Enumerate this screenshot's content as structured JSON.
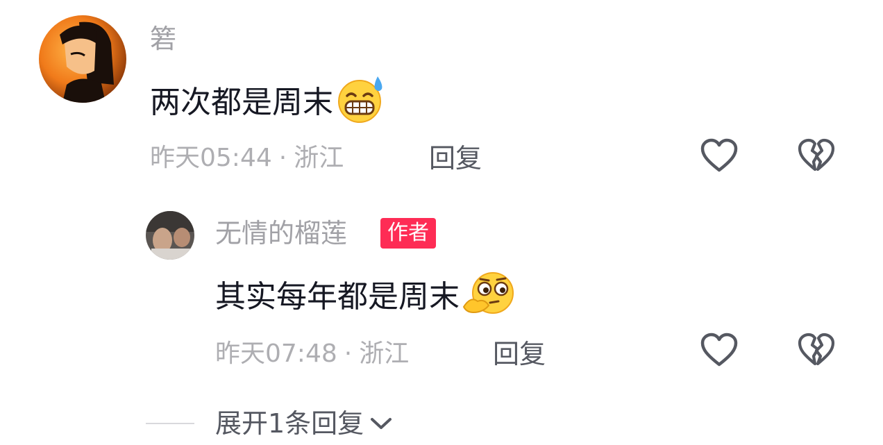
{
  "comment": {
    "username": "箬",
    "text": "两次都是周末",
    "time": "昨天05:44",
    "separator": "·",
    "location": "浙江",
    "reply_label": "回复"
  },
  "sub_comment": {
    "username": "无情的榴莲",
    "badge": "作者",
    "text": "其实每年都是周末",
    "time": "昨天07:48",
    "separator": "·",
    "location": "浙江",
    "reply_label": "回复"
  },
  "expand_label": "展开1条回复",
  "colors": {
    "badge": "#fe2c55",
    "meta": "#aeaeb2",
    "text": "#161823"
  },
  "icons": [
    "heart-outline-icon",
    "broken-heart-icon",
    "chevron-down-icon",
    "grimace-sweat-emoji",
    "thinking-emoji"
  ]
}
